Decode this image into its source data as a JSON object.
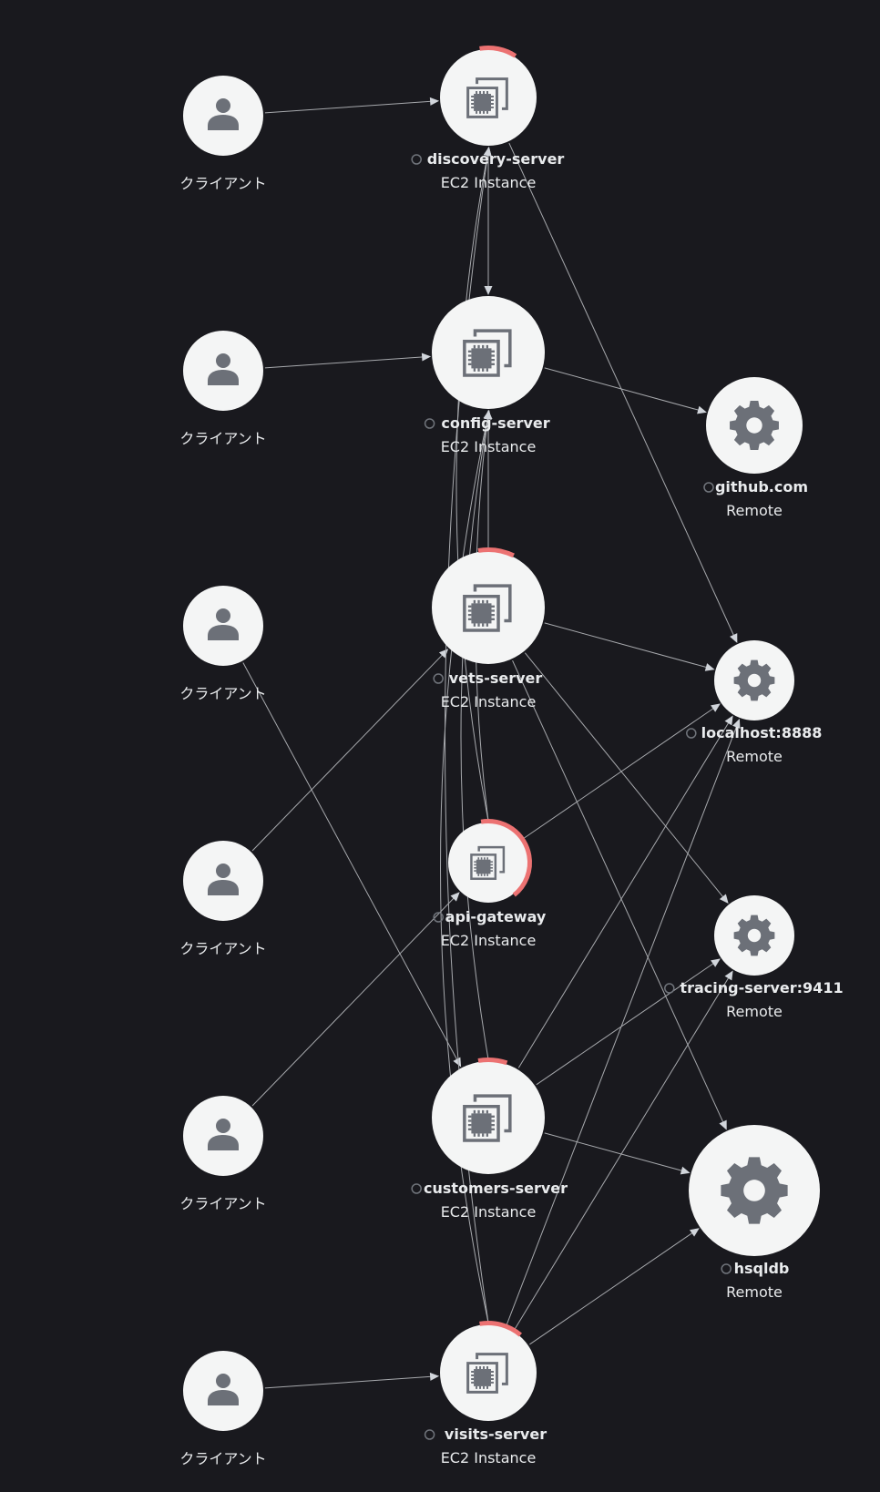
{
  "colors": {
    "background": "#19191e",
    "node_fill": "#f4f5f5",
    "icon": "#6c7078",
    "edge": "#a7a9ad",
    "text": "#e9ebed",
    "error_arc": "#ec7272"
  },
  "service_map": {
    "clients": [
      {
        "id": "client-1",
        "label": "クライアント",
        "icon": "user-icon"
      },
      {
        "id": "client-2",
        "label": "クライアント",
        "icon": "user-icon"
      },
      {
        "id": "client-3",
        "label": "クライアント",
        "icon": "user-icon"
      },
      {
        "id": "client-4",
        "label": "クライアント",
        "icon": "user-icon"
      },
      {
        "id": "client-5",
        "label": "クライアント",
        "icon": "user-icon"
      },
      {
        "id": "client-6",
        "label": "クライアント",
        "icon": "user-icon"
      }
    ],
    "services": [
      {
        "id": "discovery-server",
        "name": "discovery-server",
        "type": "EC2 Instance",
        "icon": "ec2-instance-icon",
        "error_fraction": 0.12
      },
      {
        "id": "config-server",
        "name": "config-server",
        "type": "EC2 Instance",
        "icon": "ec2-instance-icon",
        "error_fraction": 0
      },
      {
        "id": "vets-server",
        "name": "vets-server",
        "type": "EC2 Instance",
        "icon": "ec2-instance-icon",
        "error_fraction": 0.1
      },
      {
        "id": "api-gateway",
        "name": "api-gateway",
        "type": "EC2 Instance",
        "icon": "ec2-instance-icon",
        "error_fraction": 0.42
      },
      {
        "id": "customers-server",
        "name": "customers-server",
        "type": "EC2 Instance",
        "icon": "ec2-instance-icon",
        "error_fraction": 0.08
      },
      {
        "id": "visits-server",
        "name": "visits-server",
        "type": "EC2 Instance",
        "icon": "ec2-instance-icon",
        "error_fraction": 0.14
      }
    ],
    "remotes": [
      {
        "id": "github",
        "name": "github.com",
        "type": "Remote",
        "icon": "gear-icon"
      },
      {
        "id": "localhost",
        "name": "localhost:8888",
        "type": "Remote",
        "icon": "gear-icon"
      },
      {
        "id": "tracing",
        "name": "tracing-server:9411",
        "type": "Remote",
        "icon": "gear-icon"
      },
      {
        "id": "hsqldb",
        "name": "hsqldb",
        "type": "Remote",
        "icon": "gear-icon"
      }
    ],
    "edges": [
      [
        "client-1",
        "discovery-server"
      ],
      [
        "client-2",
        "config-server"
      ],
      [
        "client-3",
        "customers-server"
      ],
      [
        "client-4",
        "vets-server"
      ],
      [
        "client-5",
        "api-gateway"
      ],
      [
        "client-6",
        "visits-server"
      ],
      [
        "discovery-server",
        "config-server"
      ],
      [
        "discovery-server",
        "localhost"
      ],
      [
        "config-server",
        "github"
      ],
      [
        "vets-server",
        "config-server"
      ],
      [
        "vets-server",
        "localhost"
      ],
      [
        "vets-server",
        "tracing"
      ],
      [
        "vets-server",
        "hsqldb"
      ],
      [
        "api-gateway",
        "discovery-server"
      ],
      [
        "api-gateway",
        "config-server"
      ],
      [
        "api-gateway",
        "localhost"
      ],
      [
        "customers-server",
        "config-server"
      ],
      [
        "customers-server",
        "localhost"
      ],
      [
        "customers-server",
        "tracing"
      ],
      [
        "customers-server",
        "hsqldb"
      ],
      [
        "visits-server",
        "discovery-server"
      ],
      [
        "visits-server",
        "config-server"
      ],
      [
        "visits-server",
        "localhost"
      ],
      [
        "visits-server",
        "tracing"
      ],
      [
        "visits-server",
        "hsqldb"
      ]
    ]
  }
}
